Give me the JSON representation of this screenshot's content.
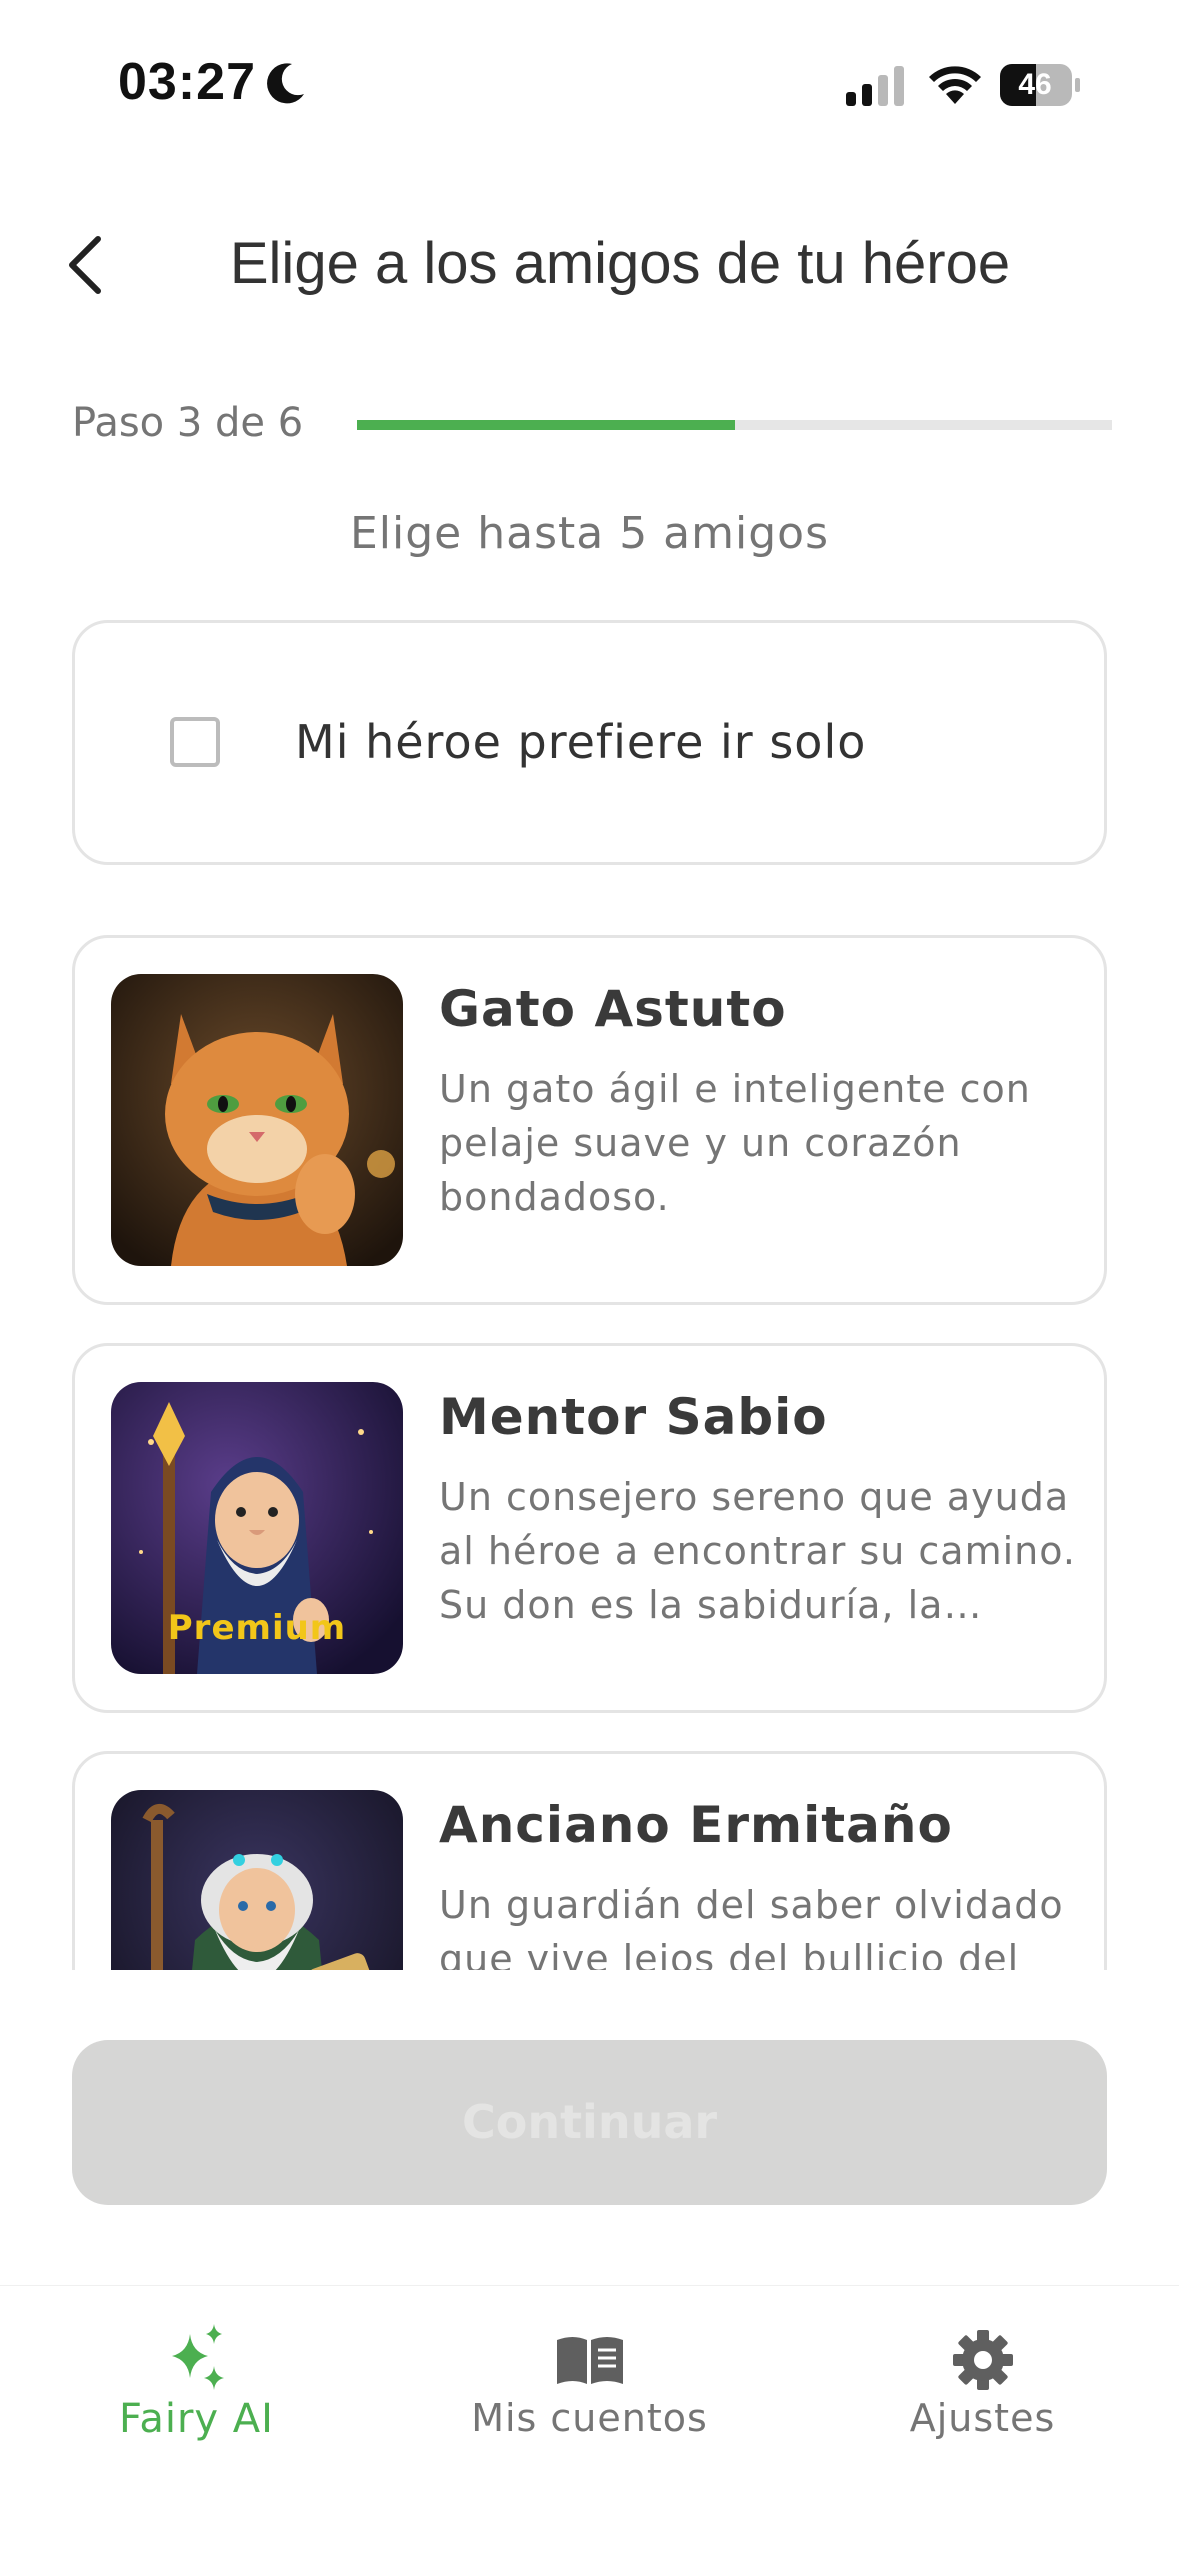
{
  "status_bar": {
    "time": "03:27",
    "battery": "46"
  },
  "header": {
    "title": "Elige a los amigos de tu héroe"
  },
  "progress": {
    "label": "Paso 3 de 6",
    "current_step": 3,
    "total_steps": 6,
    "fraction_filled": 0.5
  },
  "subtitle": "Elige hasta 5 amigos",
  "solo_option": {
    "label": "Mi héroe prefiere ir solo",
    "checked": false
  },
  "friends": [
    {
      "name": "Gato Astuto",
      "description": "Un gato ágil e inteligente con pelaje suave y un corazón bondadoso.",
      "premium": false
    },
    {
      "name": "Mentor Sabio",
      "description": "Un consejero sereno que ayuda al héroe a encontrar su camino. Su don es la sabiduría, la experiencia y la calma.",
      "premium": true,
      "badge": "Premium"
    },
    {
      "name": "Anciano Ermitaño",
      "description": "Un guardián del saber olvidado que vive lejos del bullicio del mundo.",
      "premium": false
    }
  ],
  "continue_button": {
    "label": "Continuar",
    "enabled": false
  },
  "tabs": [
    {
      "label": "Fairy AI",
      "icon": "sparkles-icon",
      "active": true
    },
    {
      "label": "Mis cuentos",
      "icon": "book-icon",
      "active": false
    },
    {
      "label": "Ajustes",
      "icon": "gear-icon",
      "active": false
    }
  ],
  "colors": {
    "accent": "#4caf50",
    "text_primary": "#333333",
    "text_secondary": "#757575",
    "premium": "#f2c619",
    "disabled_button": "#d6d6d5"
  }
}
